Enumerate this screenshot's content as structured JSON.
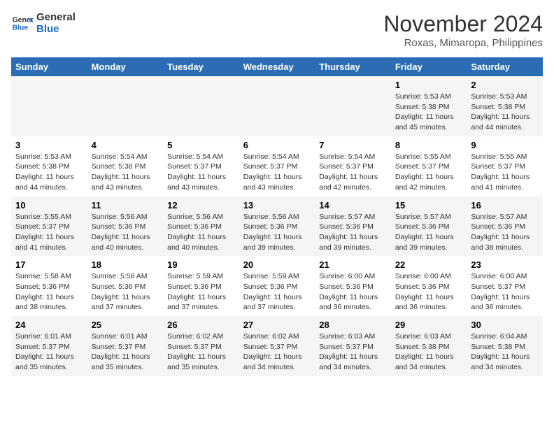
{
  "header": {
    "logo_line1": "General",
    "logo_line2": "Blue",
    "month": "November 2024",
    "location": "Roxas, Mimaropa, Philippines"
  },
  "weekdays": [
    "Sunday",
    "Monday",
    "Tuesday",
    "Wednesday",
    "Thursday",
    "Friday",
    "Saturday"
  ],
  "weeks": [
    [
      {
        "day": "",
        "info": ""
      },
      {
        "day": "",
        "info": ""
      },
      {
        "day": "",
        "info": ""
      },
      {
        "day": "",
        "info": ""
      },
      {
        "day": "",
        "info": ""
      },
      {
        "day": "1",
        "info": "Sunrise: 5:53 AM\nSunset: 5:38 PM\nDaylight: 11 hours\nand 45 minutes."
      },
      {
        "day": "2",
        "info": "Sunrise: 5:53 AM\nSunset: 5:38 PM\nDaylight: 11 hours\nand 44 minutes."
      }
    ],
    [
      {
        "day": "3",
        "info": "Sunrise: 5:53 AM\nSunset: 5:38 PM\nDaylight: 11 hours\nand 44 minutes."
      },
      {
        "day": "4",
        "info": "Sunrise: 5:54 AM\nSunset: 5:38 PM\nDaylight: 11 hours\nand 43 minutes."
      },
      {
        "day": "5",
        "info": "Sunrise: 5:54 AM\nSunset: 5:37 PM\nDaylight: 11 hours\nand 43 minutes."
      },
      {
        "day": "6",
        "info": "Sunrise: 5:54 AM\nSunset: 5:37 PM\nDaylight: 11 hours\nand 43 minutes."
      },
      {
        "day": "7",
        "info": "Sunrise: 5:54 AM\nSunset: 5:37 PM\nDaylight: 11 hours\nand 42 minutes."
      },
      {
        "day": "8",
        "info": "Sunrise: 5:55 AM\nSunset: 5:37 PM\nDaylight: 11 hours\nand 42 minutes."
      },
      {
        "day": "9",
        "info": "Sunrise: 5:55 AM\nSunset: 5:37 PM\nDaylight: 11 hours\nand 41 minutes."
      }
    ],
    [
      {
        "day": "10",
        "info": "Sunrise: 5:55 AM\nSunset: 5:37 PM\nDaylight: 11 hours\nand 41 minutes."
      },
      {
        "day": "11",
        "info": "Sunrise: 5:56 AM\nSunset: 5:36 PM\nDaylight: 11 hours\nand 40 minutes."
      },
      {
        "day": "12",
        "info": "Sunrise: 5:56 AM\nSunset: 5:36 PM\nDaylight: 11 hours\nand 40 minutes."
      },
      {
        "day": "13",
        "info": "Sunrise: 5:56 AM\nSunset: 5:36 PM\nDaylight: 11 hours\nand 39 minutes."
      },
      {
        "day": "14",
        "info": "Sunrise: 5:57 AM\nSunset: 5:36 PM\nDaylight: 11 hours\nand 39 minutes."
      },
      {
        "day": "15",
        "info": "Sunrise: 5:57 AM\nSunset: 5:36 PM\nDaylight: 11 hours\nand 39 minutes."
      },
      {
        "day": "16",
        "info": "Sunrise: 5:57 AM\nSunset: 5:36 PM\nDaylight: 11 hours\nand 38 minutes."
      }
    ],
    [
      {
        "day": "17",
        "info": "Sunrise: 5:58 AM\nSunset: 5:36 PM\nDaylight: 11 hours\nand 38 minutes."
      },
      {
        "day": "18",
        "info": "Sunrise: 5:58 AM\nSunset: 5:36 PM\nDaylight: 11 hours\nand 37 minutes."
      },
      {
        "day": "19",
        "info": "Sunrise: 5:59 AM\nSunset: 5:36 PM\nDaylight: 11 hours\nand 37 minutes."
      },
      {
        "day": "20",
        "info": "Sunrise: 5:59 AM\nSunset: 5:36 PM\nDaylight: 11 hours\nand 37 minutes."
      },
      {
        "day": "21",
        "info": "Sunrise: 6:00 AM\nSunset: 5:36 PM\nDaylight: 11 hours\nand 36 minutes."
      },
      {
        "day": "22",
        "info": "Sunrise: 6:00 AM\nSunset: 5:36 PM\nDaylight: 11 hours\nand 36 minutes."
      },
      {
        "day": "23",
        "info": "Sunrise: 6:00 AM\nSunset: 5:37 PM\nDaylight: 11 hours\nand 36 minutes."
      }
    ],
    [
      {
        "day": "24",
        "info": "Sunrise: 6:01 AM\nSunset: 5:37 PM\nDaylight: 11 hours\nand 35 minutes."
      },
      {
        "day": "25",
        "info": "Sunrise: 6:01 AM\nSunset: 5:37 PM\nDaylight: 11 hours\nand 35 minutes."
      },
      {
        "day": "26",
        "info": "Sunrise: 6:02 AM\nSunset: 5:37 PM\nDaylight: 11 hours\nand 35 minutes."
      },
      {
        "day": "27",
        "info": "Sunrise: 6:02 AM\nSunset: 5:37 PM\nDaylight: 11 hours\nand 34 minutes."
      },
      {
        "day": "28",
        "info": "Sunrise: 6:03 AM\nSunset: 5:37 PM\nDaylight: 11 hours\nand 34 minutes."
      },
      {
        "day": "29",
        "info": "Sunrise: 6:03 AM\nSunset: 5:38 PM\nDaylight: 11 hours\nand 34 minutes."
      },
      {
        "day": "30",
        "info": "Sunrise: 6:04 AM\nSunset: 5:38 PM\nDaylight: 11 hours\nand 34 minutes."
      }
    ]
  ]
}
